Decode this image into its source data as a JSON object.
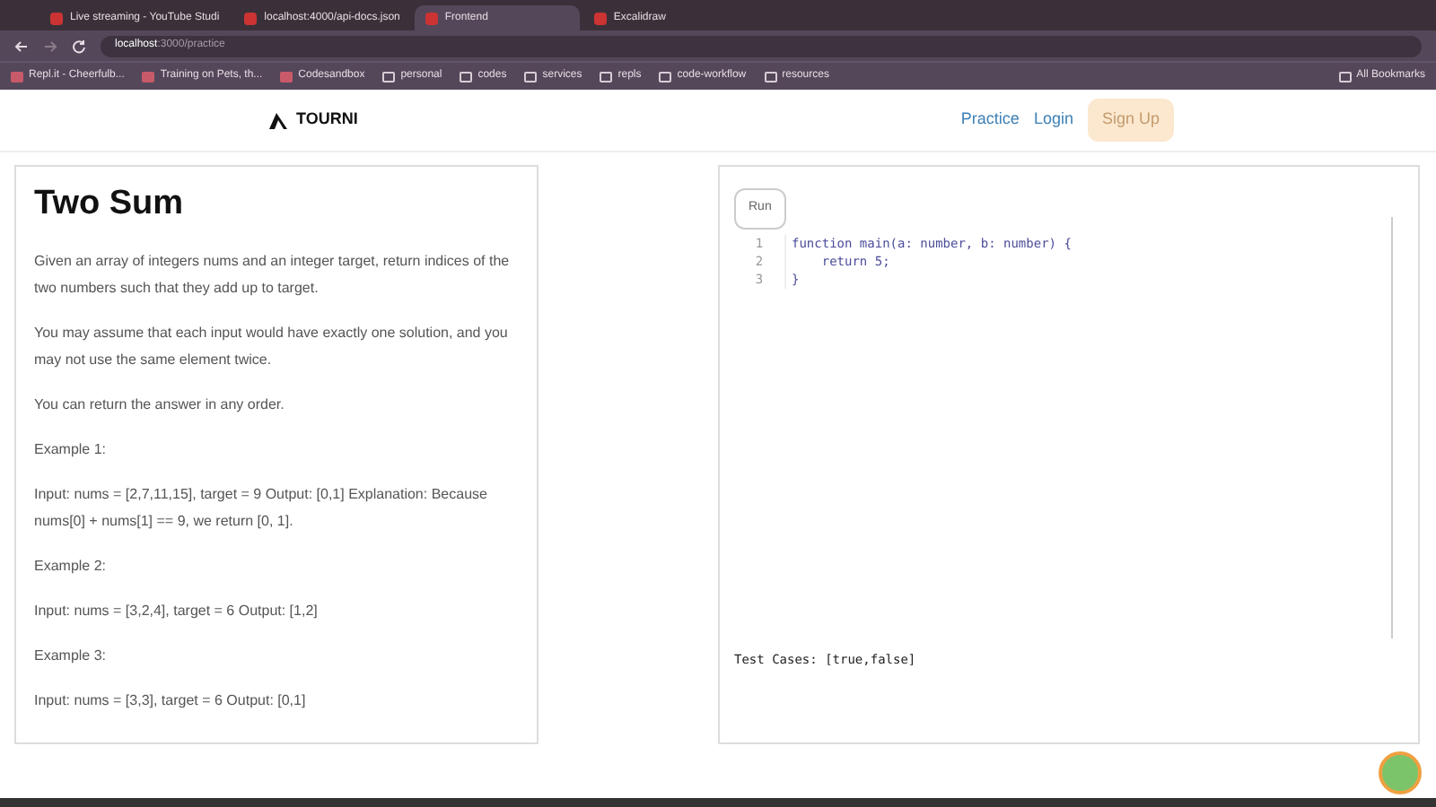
{
  "browser": {
    "tabs": [
      {
        "title": "Live streaming - YouTube Studi",
        "selected": false
      },
      {
        "title": "localhost:4000/api-docs.json",
        "selected": false
      },
      {
        "title": "Frontend",
        "selected": true
      },
      {
        "title": "Excalidraw",
        "selected": false
      }
    ],
    "address": {
      "host": "localhost",
      "path": ":3000/practice"
    },
    "bookmarks": [
      {
        "title": "Repl.it - Cheerfulb...",
        "kind": "site"
      },
      {
        "title": "Training on Pets, th...",
        "kind": "site"
      },
      {
        "title": "Codesandbox",
        "kind": "site"
      },
      {
        "title": "personal",
        "kind": "folder"
      },
      {
        "title": "codes",
        "kind": "folder"
      },
      {
        "title": "services",
        "kind": "folder"
      },
      {
        "title": "repls",
        "kind": "folder"
      },
      {
        "title": "code-workflow",
        "kind": "folder"
      },
      {
        "title": "resources",
        "kind": "folder"
      }
    ],
    "all_bookmarks": "All Bookmarks"
  },
  "navbar": {
    "brand": "TOURNI",
    "links": [
      {
        "label": "Practice",
        "kind": "link"
      },
      {
        "label": "Login",
        "kind": "link"
      },
      {
        "label": "Sign Up",
        "kind": "button"
      }
    ]
  },
  "problem": {
    "title": "Two Sum",
    "paragraphs": [
      "Given an array of integers nums and an integer target, return indices of the two numbers such that they add up to target.",
      "You may assume that each input would have exactly one solution, and you may not use the same element twice.",
      "You can return the answer in any order.",
      "Example 1:",
      "Input: nums = [2,7,11,15], target = 9 Output: [0,1] Explanation: Because nums[0] + nums[1] == 9, we return [0, 1].",
      "Example 2:",
      "Input: nums = [3,2,4], target = 6 Output: [1,2]",
      "Example 3:",
      "Input: nums = [3,3], target = 6 Output: [0,1]"
    ]
  },
  "editor": {
    "run_button": "Run",
    "lines": [
      {
        "number": "1",
        "code": "function main(a: number, b: number) {"
      },
      {
        "number": "2",
        "code": "    return 5;"
      },
      {
        "number": "3",
        "code": "}"
      }
    ],
    "test_cases": "Test Cases: [true,false]"
  }
}
